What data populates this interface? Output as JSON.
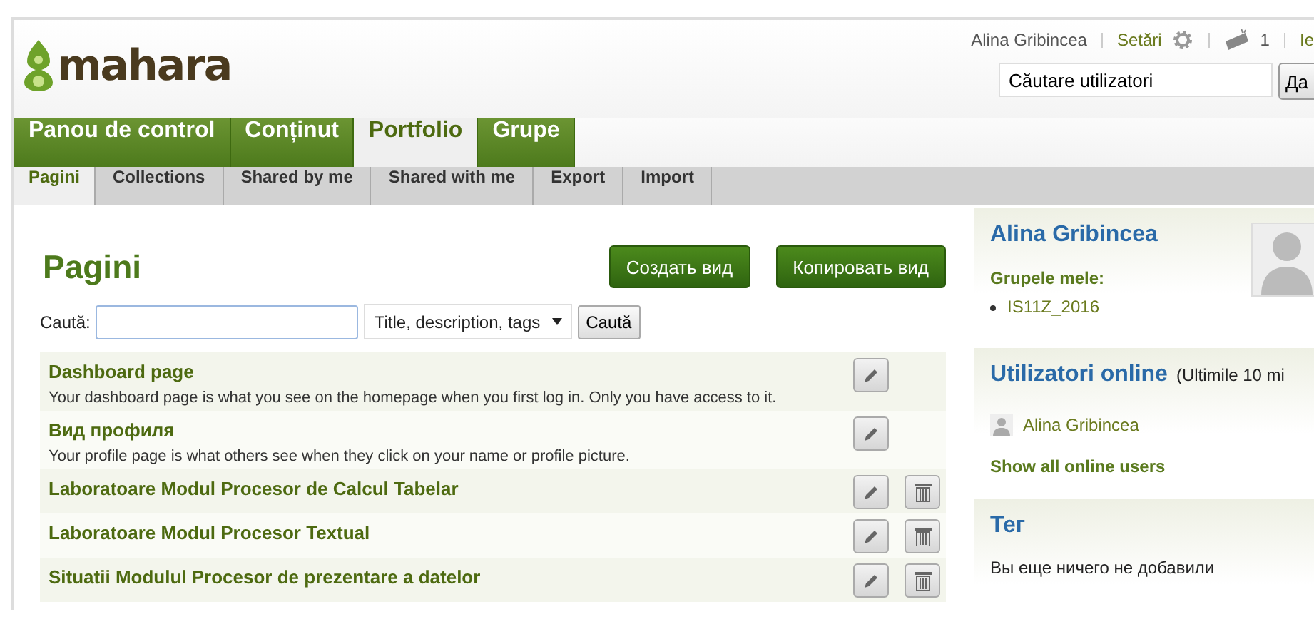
{
  "header": {
    "logo": "mahara",
    "user": "Alina Gribincea",
    "settings": "Setări",
    "messages_count": "1",
    "logout": "Ie",
    "search": {
      "value": "Căutare utilizatori"
    },
    "search_button": "Да"
  },
  "main_nav": [
    {
      "label": "Panou de control",
      "selected": false
    },
    {
      "label": "Conținut",
      "selected": false
    },
    {
      "label": "Portfolio",
      "selected": true
    },
    {
      "label": "Grupe",
      "selected": false
    }
  ],
  "sub_nav": [
    {
      "label": "Pagini",
      "selected": true
    },
    {
      "label": "Collections",
      "selected": false
    },
    {
      "label": "Shared by me",
      "selected": false
    },
    {
      "label": "Shared with me",
      "selected": false
    },
    {
      "label": "Export",
      "selected": false
    },
    {
      "label": "Import",
      "selected": false
    }
  ],
  "content": {
    "title": "Pagini",
    "buttons": [
      "Создать вид",
      "Копировать вид"
    ],
    "search_label": "Caută:",
    "search_scope": "Title, description, tags",
    "search_button": "Caută",
    "pages": [
      {
        "title": "Dashboard page",
        "description": "Your dashboard page is what you see on the homepage when you first log in. Only you have access to it.",
        "deletable": false
      },
      {
        "title": "Вид профиля",
        "description": "Your profile page is what others see when they click on your name or profile picture.",
        "deletable": false
      },
      {
        "title": "Laboratoare Modul Procesor de Calcul Tabelar",
        "deletable": true
      },
      {
        "title": "Laboratoare Modul Procesor Textual",
        "deletable": true
      },
      {
        "title": "Situatii Modulul Procesor de prezentare a datelor",
        "deletable": true
      }
    ]
  },
  "sidebar": {
    "profile": {
      "name": "Alina Gribincea",
      "groups_label": "Grupele mele:",
      "groups": [
        "IS11Z_2016"
      ]
    },
    "online": {
      "title": "Utilizatori online",
      "note": "(Ultimile 10 mi",
      "users": [
        "Alina Gribincea"
      ],
      "show_all": "Show all online users"
    },
    "tags": {
      "title": "Тег",
      "empty": "Вы еще ничего не добавили"
    }
  }
}
